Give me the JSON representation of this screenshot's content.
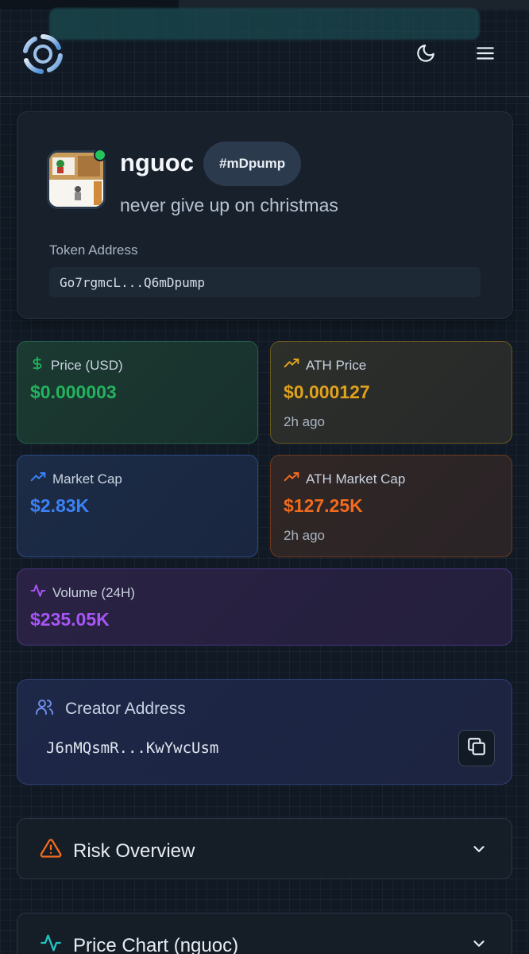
{
  "token": {
    "name": "nguoc",
    "ticker": "#mDpump",
    "description": "never give up on christmas",
    "address_label": "Token Address",
    "address": "Go7rgmcL...Q6mDpump"
  },
  "stats": {
    "price": {
      "label": "Price (USD)",
      "value": "$0.000003",
      "color": "#22b35e"
    },
    "ath_price": {
      "label": "ATH Price",
      "value": "$0.000127",
      "sub": "2h ago",
      "color": "#e0a21b"
    },
    "market_cap": {
      "label": "Market Cap",
      "value": "$2.83K",
      "color": "#3b82f6"
    },
    "ath_market_cap": {
      "label": "ATH Market Cap",
      "value": "$127.25K",
      "sub": "2h ago",
      "color": "#f26b1d"
    },
    "volume": {
      "label": "Volume (24H)",
      "value": "$235.05K",
      "color": "#a855f7"
    }
  },
  "creator": {
    "label": "Creator Address",
    "address": "J6nMQsmR...KwYwcUsm"
  },
  "sections": {
    "risk": {
      "label": "Risk Overview",
      "icon": "warning-icon"
    },
    "chart": {
      "label": "Price Chart (nguoc)",
      "icon": "activity-icon"
    }
  },
  "icons": {
    "logo": "swirl-logo",
    "theme": "moon-icon",
    "menu": "menu-icon"
  }
}
